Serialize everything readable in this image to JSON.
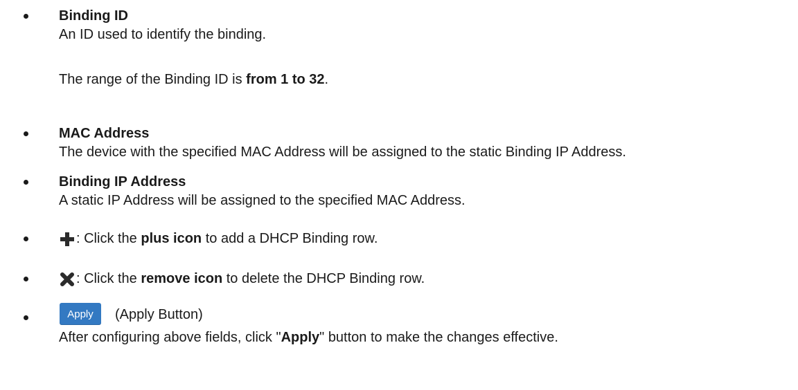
{
  "binding_id": {
    "title": "Binding ID",
    "description": "An ID used to identify the binding.",
    "range_prefix": "The range of the Binding ID is ",
    "range_value": "from 1 to 32",
    "range_suffix": "."
  },
  "mac_address": {
    "title": "MAC Address",
    "description": "The device with the specified MAC Address will be assigned to the static Binding IP Address."
  },
  "binding_ip": {
    "title": "Binding IP Address",
    "description": "A static IP Address will be assigned to the specified MAC Address."
  },
  "plus": {
    "prefix": ": Click the ",
    "bold": "plus icon",
    "suffix": " to add a DHCP Binding row."
  },
  "remove": {
    "prefix": ": Click the ",
    "bold": "remove icon",
    "suffix": " to delete the DHCP Binding row."
  },
  "apply": {
    "button_label": "Apply",
    "button_caption": "(Apply Button)",
    "desc_prefix": "After configuring above fields, click \"",
    "desc_bold": "Apply",
    "desc_suffix": "\" button to make the changes effective."
  },
  "colors": {
    "apply_button": "#3379c2",
    "icon": "#2b2b2b"
  },
  "icons": [
    "plus-icon",
    "remove-icon"
  ]
}
